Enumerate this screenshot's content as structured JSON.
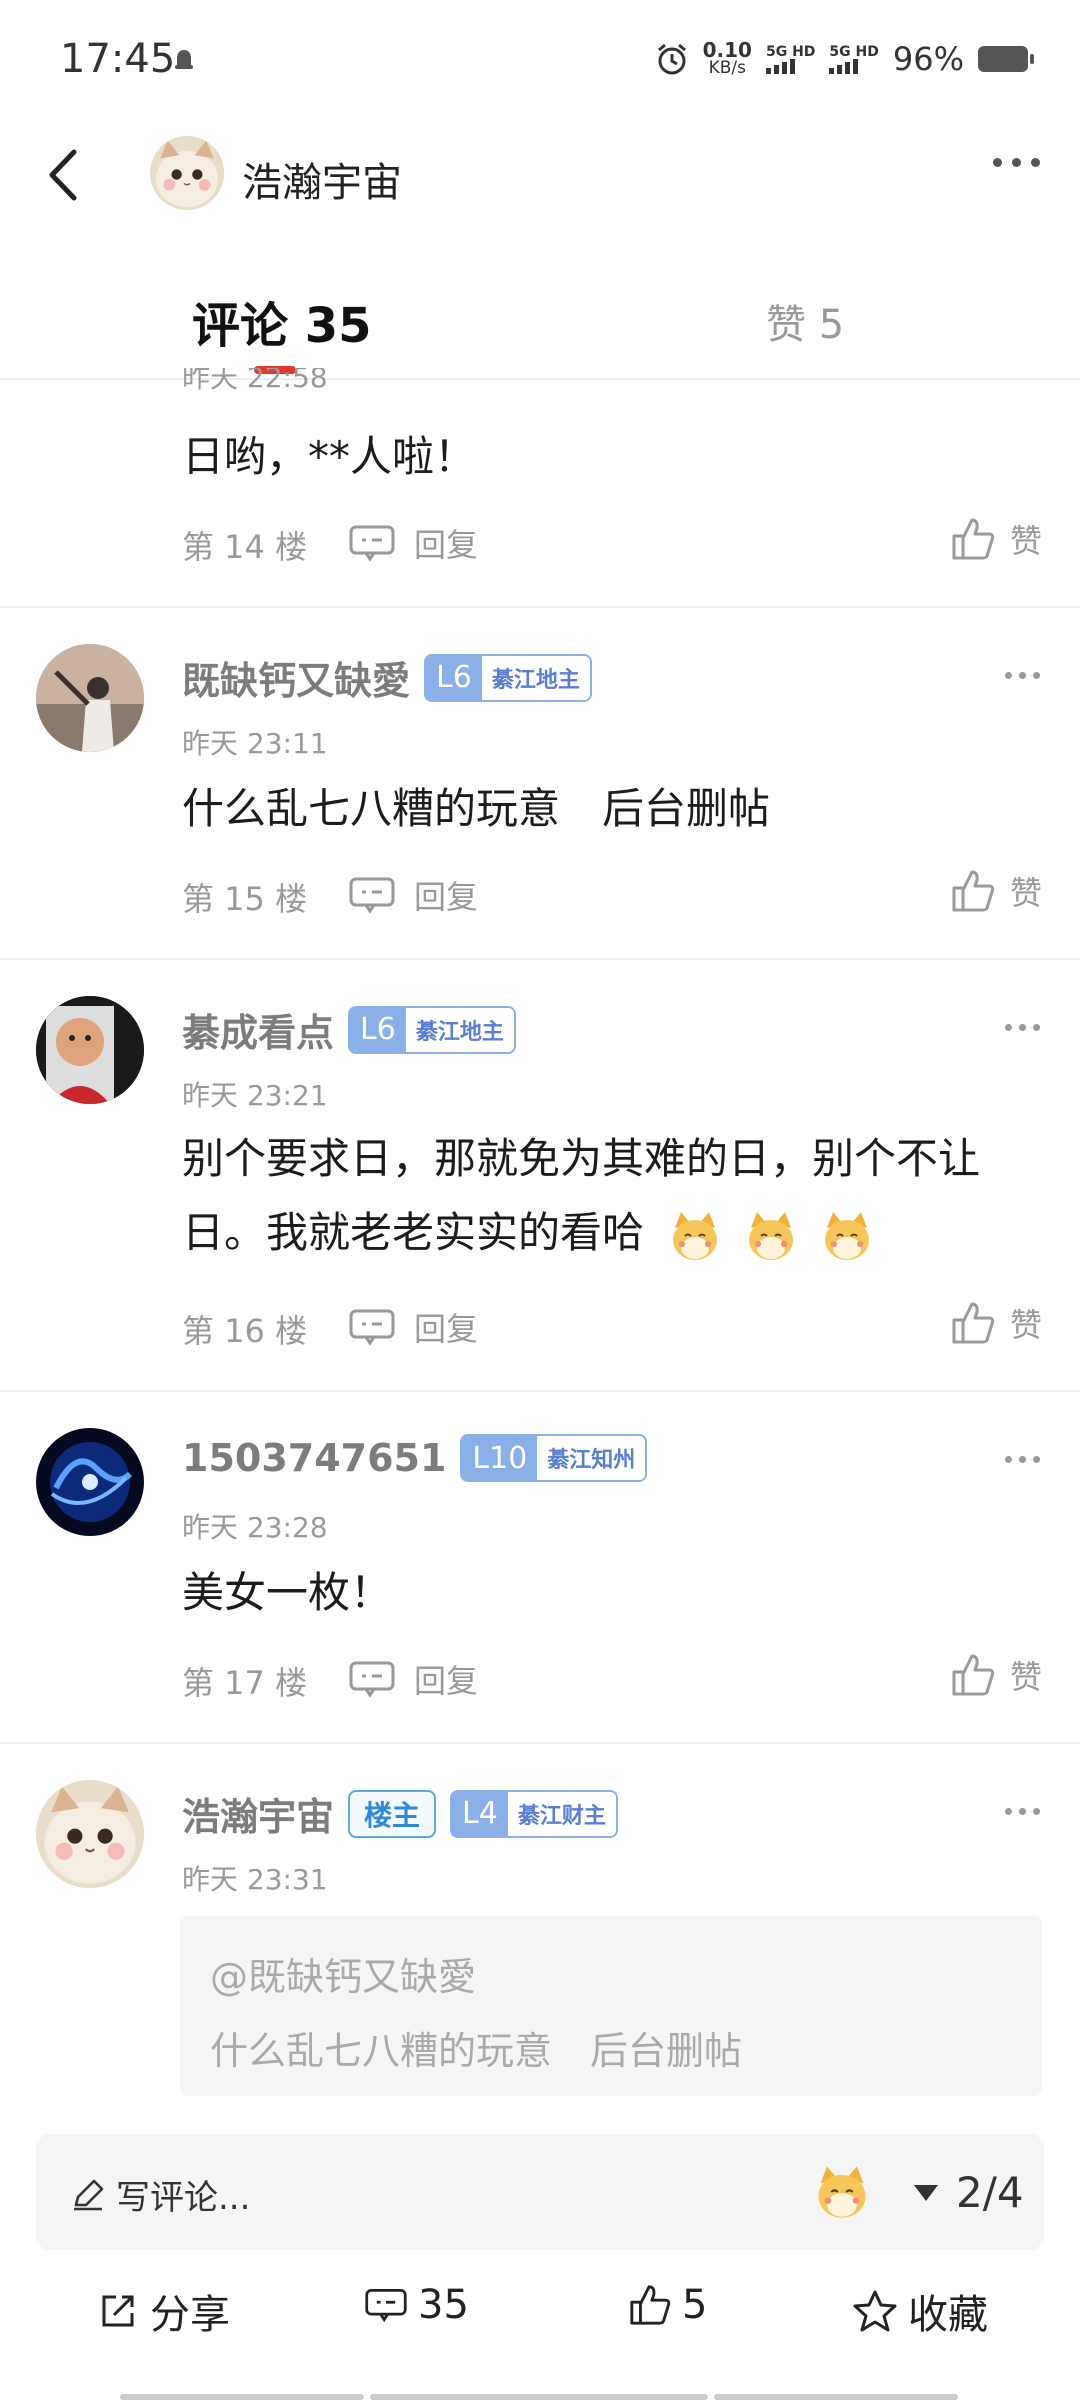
{
  "status_bar": {
    "time": "17:45",
    "net_speed": "0.10",
    "net_unit": "KB/s",
    "sim1": "5G HD",
    "sim2": "5G HD",
    "battery": "96%"
  },
  "header": {
    "title": "浩瀚宇宙"
  },
  "tabs": {
    "comments": "评论 35",
    "likes": "赞 5"
  },
  "reply_label": "回复",
  "like_label": "赞",
  "comments": [
    {
      "time": "昨天 22:58",
      "text": "日哟，**人啦！",
      "floor": "第 14 楼"
    },
    {
      "user": "既缺钙又缺愛",
      "level": "L6",
      "level_title": "綦江地主",
      "time": "昨天 23:11",
      "text": "什么乱七八糟的玩意　后台删帖",
      "floor": "第 15 楼"
    },
    {
      "user": "綦成看点",
      "level": "L6",
      "level_title": "綦江地主",
      "time": "昨天 23:21",
      "text": "别个要求日，那就免为其难的日，别个不让日。我就老老实实的看哈",
      "floor": "第 16 楼"
    },
    {
      "user": "1503747651",
      "level": "L10",
      "level_title": "綦江知州",
      "time": "昨天 23:28",
      "text": "美女一枚！",
      "floor": "第 17 楼"
    },
    {
      "user": "浩瀚宇宙",
      "owner_badge": "楼主",
      "level": "L4",
      "level_title": "綦江财主",
      "time": "昨天 23:31",
      "quote_user": "@既缺钙又缺愛",
      "quote_text": "什么乱七八糟的玩意　后台删帖"
    }
  ],
  "composer": {
    "placeholder": "写评论...",
    "page": "2/4"
  },
  "actions": {
    "share": "分享",
    "comments": "35",
    "likes": "5",
    "favorite": "收藏"
  },
  "colors": {
    "accent": "#e0392e",
    "level_badge": "#8ab0e8",
    "owner_badge": "#2f8ad6"
  }
}
